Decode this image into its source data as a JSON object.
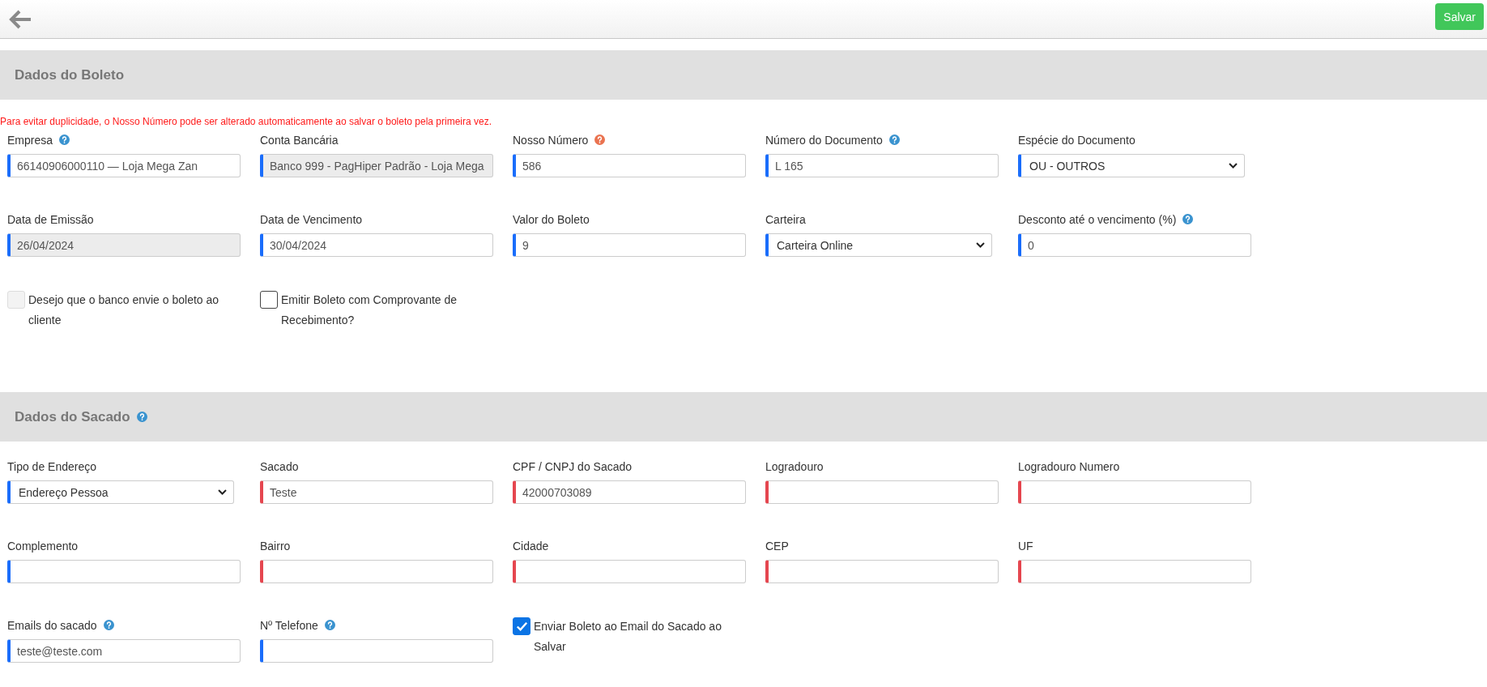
{
  "toolbar": {
    "save_label": "Salvar"
  },
  "sections": [
    {
      "title": "Dados do Boleto",
      "notice": "Para evitar duplicidade, o Nosso Número pode ser alterado automaticamente ao salvar o boleto pela primeira vez.",
      "rows": [
        [
          {
            "kind": "text",
            "label": "Empresa",
            "help": {
              "color": "#3a93cf"
            },
            "value": "66140906000110 — Loja Mega Zan",
            "required": false,
            "disabled": false
          },
          {
            "kind": "text",
            "label": "Conta Bancária",
            "value": "Banco 999 - PagHiper Padrão - Loja Mega",
            "required": false,
            "disabled": true
          },
          {
            "kind": "text",
            "label": "Nosso Número",
            "help": {
              "color": "#ea7350"
            },
            "value": "586",
            "required": false,
            "disabled": false
          },
          {
            "kind": "text",
            "label": "Número do Documento",
            "help": {
              "color": "#3a93cf"
            },
            "value": "L 165",
            "required": false,
            "disabled": false
          },
          {
            "kind": "select",
            "label": "Espécie do Documento",
            "value": "OU - OUTROS",
            "required": false,
            "disabled": false
          }
        ],
        [
          {
            "kind": "text",
            "label": "Data de Emissão",
            "value": "26/04/2024",
            "required": false,
            "disabled": true
          },
          {
            "kind": "text",
            "label": "Data de Vencimento",
            "value": "30/04/2024",
            "required": false,
            "disabled": false
          },
          {
            "kind": "text",
            "label": "Valor do Boleto",
            "value": "9",
            "required": false,
            "disabled": false
          },
          {
            "kind": "select",
            "label": "Carteira",
            "value": "Carteira Online",
            "required": false,
            "disabled": false
          },
          {
            "kind": "text",
            "label": "Desconto até o vencimento (%)",
            "help": {
              "color": "#3a93cf"
            },
            "value": "0",
            "required": false,
            "disabled": false
          }
        ],
        [
          {
            "kind": "checkbox",
            "label": "Desejo que o banco envie o boleto ao cliente",
            "checked": false,
            "disabled": true
          },
          {
            "kind": "checkbox",
            "label": "Emitir Boleto com Comprovante de Recebimento?",
            "checked": false,
            "disabled": false
          }
        ]
      ]
    },
    {
      "title": "Dados do Sacado",
      "help": {
        "color": "#3a93cf"
      },
      "rows": [
        [
          {
            "kind": "select",
            "label": "Tipo de Endereço",
            "value": "Endereço Pessoa",
            "required": false,
            "disabled": false
          },
          {
            "kind": "text",
            "label": "Sacado",
            "value": "Teste",
            "required": true,
            "disabled": false
          },
          {
            "kind": "text",
            "label": "CPF / CNPJ do Sacado",
            "value": "42000703089",
            "required": true,
            "disabled": false
          },
          {
            "kind": "text",
            "label": "Logradouro",
            "required": true,
            "disabled": false
          },
          {
            "kind": "text",
            "label": "Logradouro Numero",
            "required": true,
            "disabled": false
          }
        ],
        [
          {
            "kind": "text",
            "label": "Complemento",
            "required": false,
            "disabled": false
          },
          {
            "kind": "text",
            "label": "Bairro",
            "required": true,
            "disabled": false
          },
          {
            "kind": "text",
            "label": "Cidade",
            "required": true,
            "disabled": false
          },
          {
            "kind": "text",
            "label": "CEP",
            "required": true,
            "disabled": false
          },
          {
            "kind": "text",
            "label": "UF",
            "required": true,
            "disabled": false
          }
        ],
        [
          {
            "kind": "text",
            "label": "Emails do sacado",
            "help": {
              "color": "#3a93cf"
            },
            "value": "teste@teste.com",
            "required": false,
            "disabled": false
          },
          {
            "kind": "text",
            "label": "Nº Telefone",
            "help": {
              "color": "#3a93cf"
            },
            "required": false,
            "disabled": false
          },
          {
            "kind": "checkbox",
            "label": "Enviar Boleto ao Email do Sacado ao Salvar",
            "checked": true,
            "disabled": false
          }
        ]
      ]
    }
  ]
}
